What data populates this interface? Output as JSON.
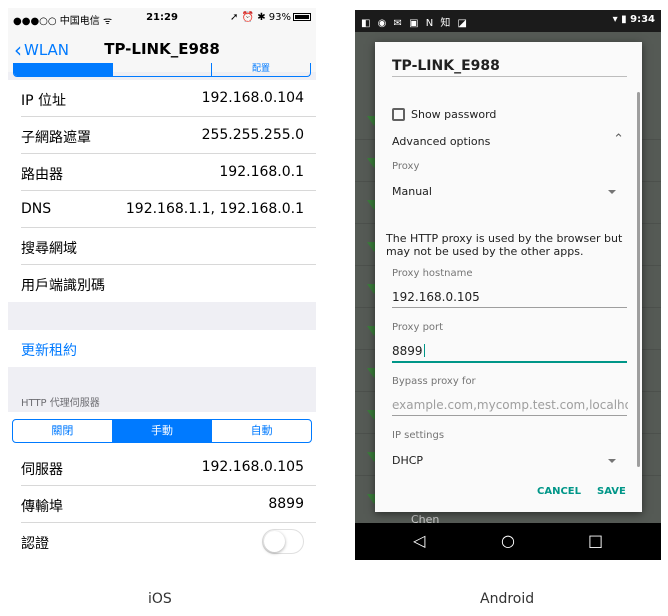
{
  "ios": {
    "status": {
      "carrier": "●●●○○ 中国电信 ᯤ",
      "time": "21:29",
      "right": "➚ ⏰ ✱ 93%"
    },
    "nav": {
      "back_label": "WLAN",
      "title": "TP-LINK_E988"
    },
    "top_segments": [
      "",
      "",
      "配置"
    ],
    "info_rows": [
      {
        "label": "IP 位址",
        "value": "192.168.0.104"
      },
      {
        "label": "子網路遮罩",
        "value": "255.255.255.0"
      },
      {
        "label": "路由器",
        "value": "192.168.0.1"
      },
      {
        "label": "DNS",
        "value": "192.168.1.1, 192.168.0.1"
      },
      {
        "label": "搜尋網域",
        "value": ""
      },
      {
        "label": "用戶端識別碼",
        "value": ""
      }
    ],
    "renew_lease": "更新租約",
    "http_proxy_header": "HTTP 代理伺服器",
    "proxy_segments": [
      "關閉",
      "手動",
      "自動"
    ],
    "proxy_selected": "手動",
    "proxy_rows": [
      {
        "label": "伺服器",
        "value": "192.168.0.105"
      },
      {
        "label": "傳輸埠",
        "value": "8899"
      },
      {
        "label": "認證",
        "value": ""
      }
    ],
    "auth_toggle_on": false
  },
  "android": {
    "status": {
      "left_icons": "◧ ◉ ✉ ▣ N 知 ◪",
      "right": "▾ ▮ 9:34"
    },
    "dialog": {
      "title": "TP-LINK_E988",
      "show_password": "Show password",
      "advanced_options": "Advanced options",
      "proxy_label": "Proxy",
      "proxy_value": "Manual",
      "proxy_note": "The HTTP proxy is used by the browser but may not be used by the other apps.",
      "hostname_label": "Proxy hostname",
      "hostname_value": "192.168.0.105",
      "port_label": "Proxy port",
      "port_value": "8899",
      "bypass_label": "Bypass proxy for",
      "bypass_placeholder": "example.com,mycomp.test.com,localhost",
      "ip_settings_label": "IP settings",
      "ip_settings_value": "DHCP",
      "cancel": "CANCEL",
      "save": "SAVE"
    },
    "background_item": "Chen",
    "navbar": {
      "back": "◁",
      "home": "○",
      "recents": "□"
    }
  },
  "captions": {
    "ios": "iOS",
    "android": "Android"
  },
  "colors": {
    "ios_accent": "#007aff",
    "android_accent": "#009688"
  }
}
